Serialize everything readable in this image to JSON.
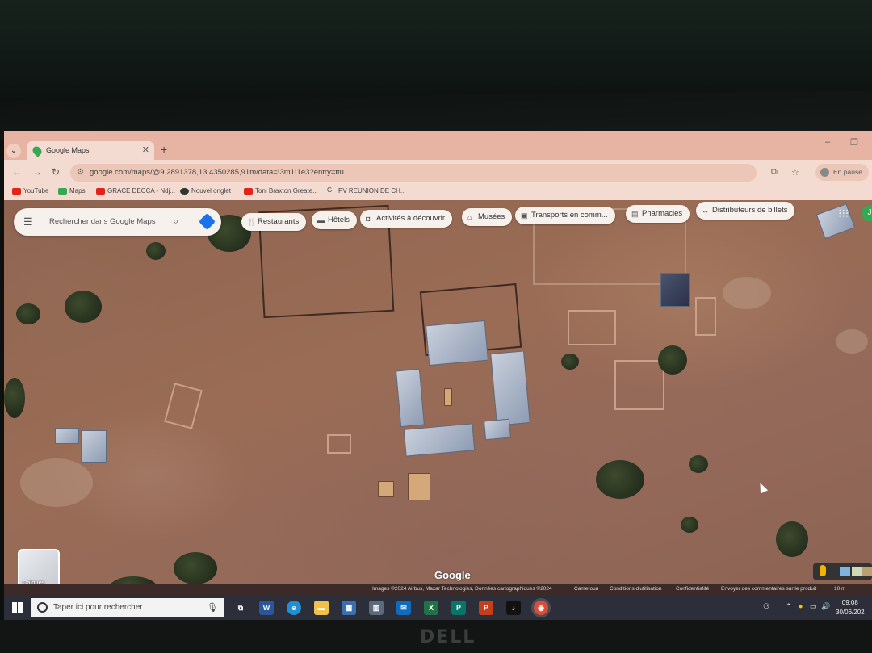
{
  "browser": {
    "tab_title": "Google Maps",
    "url": "google.com/maps/@9.2891378,13.4350285,91m/data=!3m1!1e3?entry=ttu",
    "profile_label": "En pause",
    "bookmarks": [
      "YouTube",
      "Maps",
      "GRACE DECCA - Ndj...",
      "Nouvel onglet",
      "Toni Braxton Greate...",
      "PV REUNION DE CH..."
    ]
  },
  "maps": {
    "search_placeholder": "Rechercher dans Google Maps",
    "chips": [
      "Restaurants",
      "Hôtels",
      "Activités à découvrir",
      "Musées",
      "Transports en comm...",
      "Pharmacies",
      "Distributeurs de billets"
    ],
    "layers_label": "Calques",
    "logo_text": "Google",
    "attribution": "Images ©2024 Airbus, Maxar Technologies, Données cartographiques ©2024",
    "country": "Cameroun",
    "footer_links": [
      "Conditions d'utilisation",
      "Confidentialité",
      "Envoyer des commentaires sur le produit"
    ],
    "scale": "10 m"
  },
  "taskbar": {
    "search_placeholder": "Taper ici pour rechercher",
    "time": "09:08",
    "date": "30/06/202"
  },
  "colors": {
    "tab_strip": "#e7b4a3",
    "toolbar": "#f4dbd1",
    "taskbar": "#2c2f3a",
    "map_ground": "#9a6c55"
  }
}
